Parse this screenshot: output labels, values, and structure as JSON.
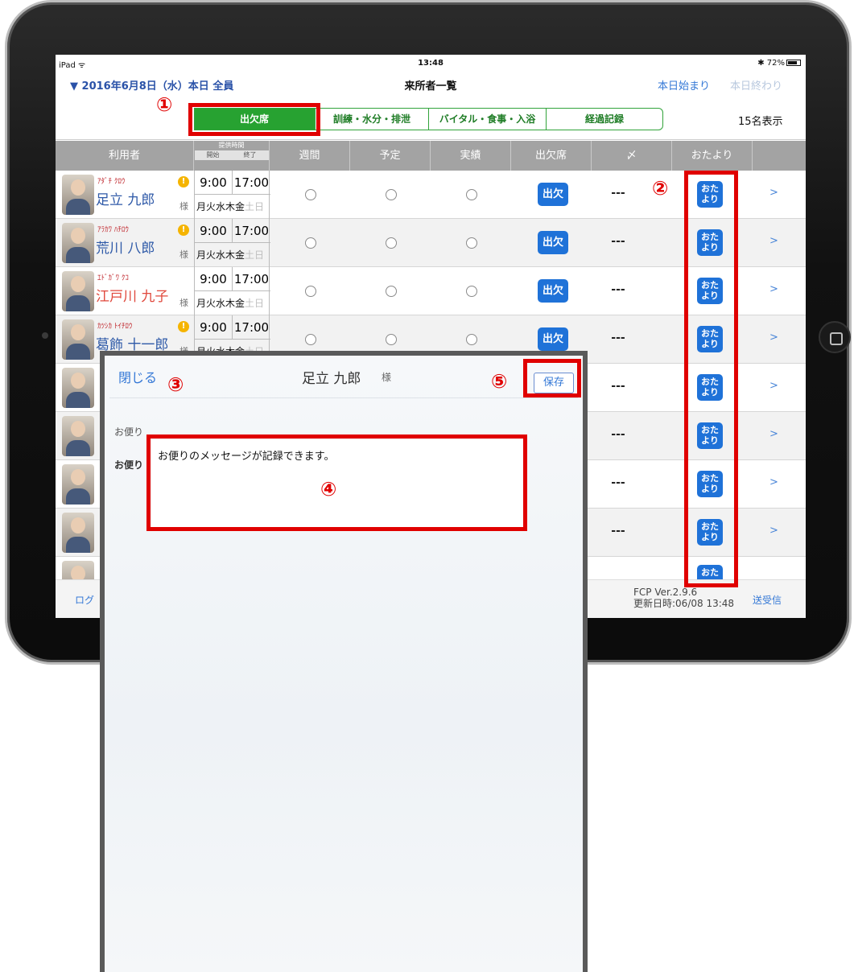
{
  "status_bar": {
    "device": "iPad ᯤ",
    "time": "13:48",
    "battery": "✱ 72%"
  },
  "nav": {
    "date": "▼ 2016年6月8日（水）本日 全員",
    "title": "来所者一覧",
    "start_label": "本日始まり",
    "end_label": "本日終わり"
  },
  "segments": [
    {
      "label": "出欠席",
      "active": true
    },
    {
      "label": "訓練・水分・排泄",
      "active": false
    },
    {
      "label": "バイタル・食事・入浴",
      "active": false
    },
    {
      "label": "経過記録",
      "active": false
    }
  ],
  "count_label": "15名表示",
  "table_header": {
    "user": "利用者",
    "time_title": "提供時間",
    "time_start": "開始",
    "time_end": "終了",
    "weekly": "週間",
    "planned": "予定",
    "actual": "実績",
    "attendance": "出欠席",
    "check": "〆",
    "note": "おたより"
  },
  "rows": [
    {
      "kana": "ｱﾀﾞﾁ ｸﾛｳ",
      "name": "足立 九郎",
      "warn": true,
      "start": "9:00",
      "end": "17:00",
      "sama": "様",
      "days_on": "月火水木金",
      "days_off": "土日",
      "attendance": "出欠",
      "check": "---",
      "note": "おたより",
      "chevron": ">"
    },
    {
      "kana": "ｱﾗｶﾜ ﾊﾁﾛｳ",
      "name": "荒川 八郎",
      "warn": true,
      "start": "9:00",
      "end": "17:00",
      "sama": "様",
      "days_on": "月火水木金",
      "days_off": "土日",
      "attendance": "出欠",
      "check": "---",
      "note": "おたより",
      "chevron": ">"
    },
    {
      "kana": "ｴﾄﾞｶﾞﾜ ｸｺ",
      "name": "江戸川 九子",
      "warn": false,
      "start": "9:00",
      "end": "17:00",
      "sama": "様",
      "days_on": "月火水木金",
      "days_off": "土日",
      "attendance": "出欠",
      "check": "---",
      "note": "おたより",
      "chevron": ">"
    },
    {
      "kana": "ｶﾂｼｶ ﾄｲﾁﾛｳ",
      "name": "葛飾 十一郎",
      "warn": true,
      "start": "9:00",
      "end": "17:00",
      "sama": "様",
      "days_on": "月火水木金",
      "days_off": "土日",
      "attendance": "出欠",
      "check": "---",
      "note": "おたより",
      "chevron": ">"
    },
    {
      "check": "---",
      "note": "おたより",
      "chevron": ">"
    },
    {
      "check": "---",
      "note": "おたより",
      "chevron": ">"
    },
    {
      "check": "---",
      "note": "おたより",
      "chevron": ">"
    },
    {
      "check": "---",
      "note": "おたより",
      "chevron": ">"
    },
    {
      "note": "おた"
    }
  ],
  "footer": {
    "logout": "ログ",
    "version_line1": "FCP Ver.2.9.6",
    "version_line2": "更新日時:06/08 13:48",
    "send_receive": "送受信"
  },
  "modal": {
    "close": "閉じる",
    "user_name": "足立 九郎",
    "sama": "様",
    "save": "保存",
    "section_label": "お便り",
    "field_label": "お便り",
    "message": "お便りのメッセージが記録できます。"
  },
  "markers": [
    "①",
    "②",
    "③",
    "④",
    "⑤"
  ],
  "colors": {
    "accent_blue": "#1f72d8",
    "segment_green": "#27a231",
    "annotation_red": "#e00000",
    "header_gray": "#a3a3a3"
  }
}
